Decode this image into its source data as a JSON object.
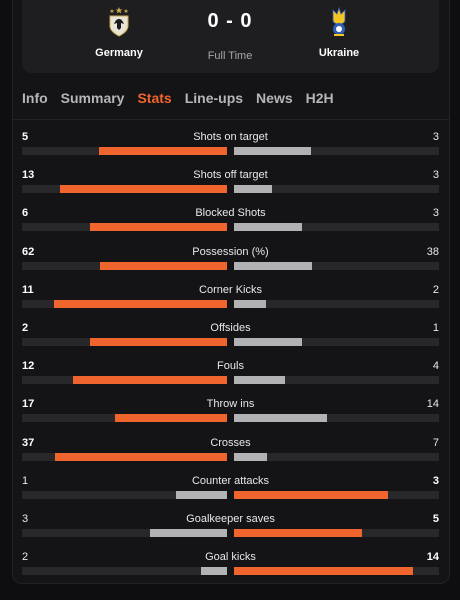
{
  "match": {
    "home": {
      "name": "Germany",
      "crest": "germany-crest-icon"
    },
    "away": {
      "name": "Ukraine",
      "crest": "ukraine-crest-icon"
    },
    "score": "0 - 0",
    "status": "Full Time"
  },
  "tabs": [
    {
      "label": "Info",
      "active": false
    },
    {
      "label": "Summary",
      "active": false
    },
    {
      "label": "Stats",
      "active": true
    },
    {
      "label": "Line-ups",
      "active": false
    },
    {
      "label": "News",
      "active": false
    },
    {
      "label": "H2H",
      "active": false
    }
  ],
  "colors": {
    "accent": "#f0642d",
    "secondary_bar": "#b2b2b5",
    "track": "#28282b"
  },
  "stats": [
    {
      "label": "Shots on target",
      "home": 5,
      "away": 3
    },
    {
      "label": "Shots off target",
      "home": 13,
      "away": 3
    },
    {
      "label": "Blocked Shots",
      "home": 6,
      "away": 3
    },
    {
      "label": "Possession (%)",
      "home": 62,
      "away": 38
    },
    {
      "label": "Corner Kicks",
      "home": 11,
      "away": 2
    },
    {
      "label": "Offsides",
      "home": 2,
      "away": 1
    },
    {
      "label": "Fouls",
      "home": 12,
      "away": 4
    },
    {
      "label": "Throw ins",
      "home": 17,
      "away": 14
    },
    {
      "label": "Crosses",
      "home": 37,
      "away": 7
    },
    {
      "label": "Counter attacks",
      "home": 1,
      "away": 3
    },
    {
      "label": "Goalkeeper saves",
      "home": 3,
      "away": 5
    },
    {
      "label": "Goal kicks",
      "home": 2,
      "away": 14
    }
  ]
}
